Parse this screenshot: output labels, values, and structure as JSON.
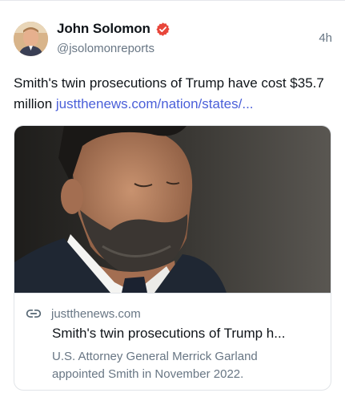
{
  "author": {
    "display_name": "John Solomon",
    "handle": "@jsolomonreports",
    "verified": true,
    "avatar_icon": "avatar-photo"
  },
  "post": {
    "time": "4h",
    "text": "Smith's twin prosecutions of Trump have cost $35.7 million ",
    "link_text": "justthenews.com/nation/states/..."
  },
  "card": {
    "image_alt": "photo",
    "domain": "justthenews.com",
    "title": "Smith's twin prosecutions of Trump h...",
    "description": "U.S. Attorney General Merrick Garland appointed Smith in November 2022."
  },
  "colors": {
    "verified_badge": "#e8463a",
    "link": "#4a5fd9",
    "secondary_text": "#687684"
  }
}
